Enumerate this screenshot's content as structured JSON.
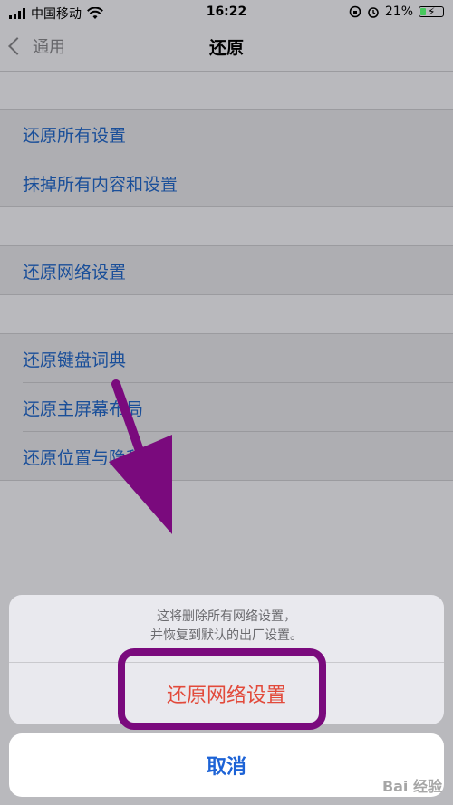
{
  "status_bar": {
    "carrier": "中国移动",
    "time": "16:22",
    "battery_percent": "21%",
    "icons": [
      "signal-icon",
      "wifi-icon",
      "lock-rotation-icon",
      "alarm-icon",
      "battery-charging-icon"
    ]
  },
  "nav": {
    "back_label": "通用",
    "title": "还原"
  },
  "list": {
    "section1": [
      "还原所有设置",
      "抹掉所有内容和设置"
    ],
    "section2": [
      "还原网络设置"
    ],
    "section3": [
      "还原键盘词典",
      "还原主屏幕布局",
      "还原位置与隐私"
    ]
  },
  "action_sheet": {
    "message_line1": "这将删除所有网络设置，",
    "message_line2": "并恢复到默认的出厂设置。",
    "destructive_label": "还原网络设置",
    "cancel_label": "取消"
  },
  "watermark": "Bai 经验",
  "colors": {
    "accent_blue": "#1d56a7",
    "destructive_red": "#e24a3b",
    "annotation_purple": "#7a0a7d"
  }
}
